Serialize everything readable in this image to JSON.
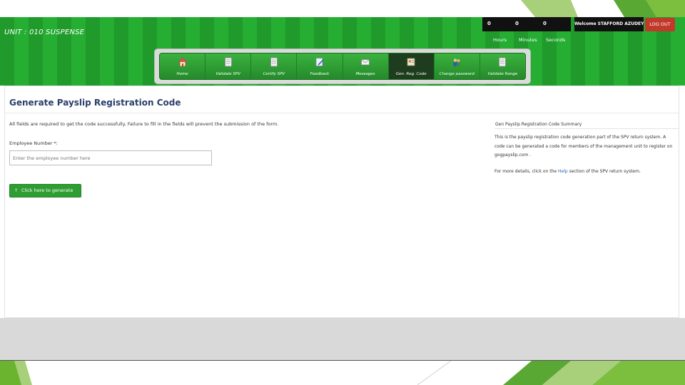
{
  "header": {
    "unit_label": "UNIT : 010 SUSPENSE",
    "timer": {
      "hours_value": "0",
      "minutes_value": "0",
      "seconds_value": "0",
      "hours_label": "Hours",
      "minutes_label": "Minutes",
      "seconds_label": "Seconds"
    },
    "welcome_text": "Welcome STAFFORD AZUDEY",
    "logout_label": "LOG OUT"
  },
  "nav": {
    "items": [
      {
        "label": "Home",
        "icon": "home-icon"
      },
      {
        "label": "Validate SPV",
        "icon": "document-icon"
      },
      {
        "label": "Certify SPV",
        "icon": "document-icon"
      },
      {
        "label": "Feedback",
        "icon": "edit-icon"
      },
      {
        "label": "Messages",
        "icon": "mail-icon"
      },
      {
        "label": "Gen. Reg. Code",
        "icon": "id-card-icon",
        "active": true
      },
      {
        "label": "Change password",
        "icon": "users-icon"
      },
      {
        "label": "Validate Range",
        "icon": "document-icon"
      }
    ]
  },
  "panel": {
    "title": "Generate Payslip Registration Code",
    "instructions": "All fields are required to get the code successfully. Failure to fill in the fields will prevent the submission of the form.",
    "employee_label": "Employee Number *:",
    "employee_placeholder": "Enter the employee number here",
    "generate_button": "Click here to generate"
  },
  "summary": {
    "title": "Gen Payslip Registration Code Summary",
    "text": "This is the payslip registration code generation part of the SPV return system. A code can be generated a code for members of the management unit to register on gogpayslip.com .",
    "help_prefix": "For more details, click on the",
    "help_link": "Help",
    "help_suffix": "section of the SPV return system."
  },
  "colors": {
    "header_green": "#26ae33",
    "nav_active": "#1d3d1e",
    "logout_red": "#c0392b",
    "title_blue": "#2a3f6a",
    "button_green": "#2f9e32"
  }
}
